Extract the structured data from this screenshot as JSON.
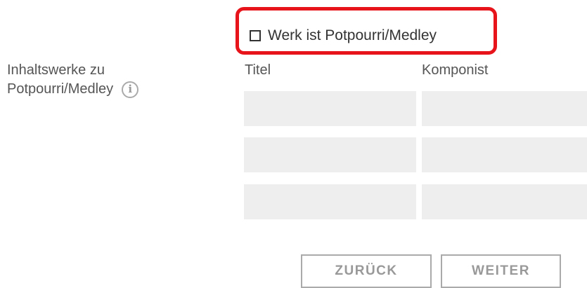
{
  "medley_checkbox": {
    "label": "Werk ist Potpourri/Medley",
    "checked": false
  },
  "content_works": {
    "label_line1": "Inhaltswerke zu",
    "label_line2": "Potpourri/Medley",
    "info_icon": "info-icon",
    "columns": [
      "Titel",
      "Komponist"
    ],
    "rows": [
      {
        "titel": "",
        "komponist": ""
      },
      {
        "titel": "",
        "komponist": ""
      },
      {
        "titel": "",
        "komponist": ""
      }
    ]
  },
  "buttons": {
    "back_label": "ZURÜCK",
    "next_label": "WEITER"
  },
  "colors": {
    "highlight": "#e8141c",
    "input_bg": "#eeeeee",
    "button_border": "#aaaaaa"
  }
}
